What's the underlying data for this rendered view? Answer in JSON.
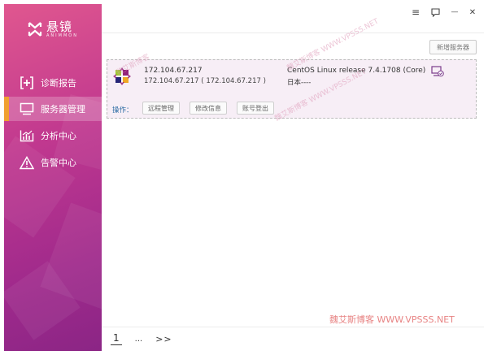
{
  "app": {
    "logo_cn": "悬镜",
    "logo_en": "ANIMMON"
  },
  "sidebar": {
    "items": [
      {
        "label": "诊断报告",
        "icon": "plus-square-icon",
        "active": false
      },
      {
        "label": "服务器管理",
        "icon": "monitor-icon",
        "active": true
      },
      {
        "label": "分析中心",
        "icon": "bar-chart-icon",
        "active": false
      },
      {
        "label": "告警中心",
        "icon": "warning-icon",
        "active": false
      }
    ]
  },
  "window_controls": {
    "menu": "≡",
    "chat": "chat-bubble-icon",
    "minimize": "—",
    "close": "✕"
  },
  "toolbar": {
    "add_server_label": "新增服务器"
  },
  "server": {
    "host": "172.104.67.217",
    "host_detail": "172.104.67.217 ( 172.104.67.217 )",
    "os_name": "CentOS Linux release 7.4.1708 (Core)",
    "location": "日本----",
    "ops_label": "操作：",
    "ops": [
      {
        "label": "远程管理"
      },
      {
        "label": "修改信息"
      },
      {
        "label": "账号登出"
      }
    ]
  },
  "watermarks": {
    "diag1": "魏艾斯博客 WWW.VPSSS.NET",
    "diag2": "魏艾斯博客 WWW.VPSSS.NET",
    "diag3": "魏艾斯博客",
    "bottom": "魏艾斯博客 WWW.VPSSS.NET"
  },
  "pagination": {
    "current": "1",
    "ellipsis": "...",
    "next": ">>"
  },
  "colors": {
    "sidebar_start": "#e0578f",
    "sidebar_end": "#8b2585",
    "active_indicator": "#f0a030",
    "card_bg": "#f7eef6",
    "ops_label": "#2e6da4"
  }
}
